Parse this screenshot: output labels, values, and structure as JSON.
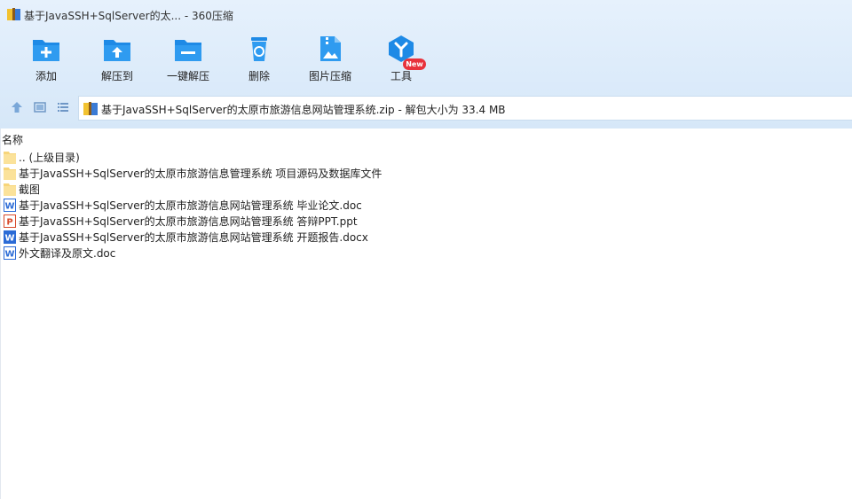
{
  "window": {
    "title": "基于JavaSSH+SqlServer的太... - 360压缩"
  },
  "toolbar": {
    "items": [
      {
        "label": "添加",
        "icon": "add-folder-icon"
      },
      {
        "label": "解压到",
        "icon": "extract-to-icon"
      },
      {
        "label": "一键解压",
        "icon": "one-click-extract-icon"
      },
      {
        "label": "删除",
        "icon": "recycle-delete-icon"
      },
      {
        "label": "图片压缩",
        "icon": "image-compress-icon"
      },
      {
        "label": "工具",
        "icon": "tools-icon"
      }
    ],
    "new_badge": "New"
  },
  "address": {
    "path": "基于JavaSSH+SqlServer的太原市旅游信息网站管理系统.zip - 解包大小为 33.4 MB"
  },
  "list": {
    "column_name": "名称",
    "files": [
      {
        "name": ".. (上级目录)",
        "type": "folder"
      },
      {
        "name": "基于JavaSSH+SqlServer的太原市旅游信息管理系统 项目源码及数据库文件",
        "type": "folder"
      },
      {
        "name": "截图",
        "type": "folder"
      },
      {
        "name": "基于JavaSSH+SqlServer的太原市旅游信息网站管理系统 毕业论文.doc",
        "type": "word-doc"
      },
      {
        "name": "基于JavaSSH+SqlServer的太原市旅游信息网站管理系统 答辩PPT.ppt",
        "type": "ppt"
      },
      {
        "name": "基于JavaSSH+SqlServer的太原市旅游信息网站管理系统 开题报告.docx",
        "type": "word-docx"
      },
      {
        "name": "外文翻译及原文.doc",
        "type": "word-doc"
      }
    ]
  },
  "colors": {
    "accent_blue": "#1e8ae6",
    "badge_red": "#e8323c",
    "folder_yellow": "#f7d57a"
  }
}
